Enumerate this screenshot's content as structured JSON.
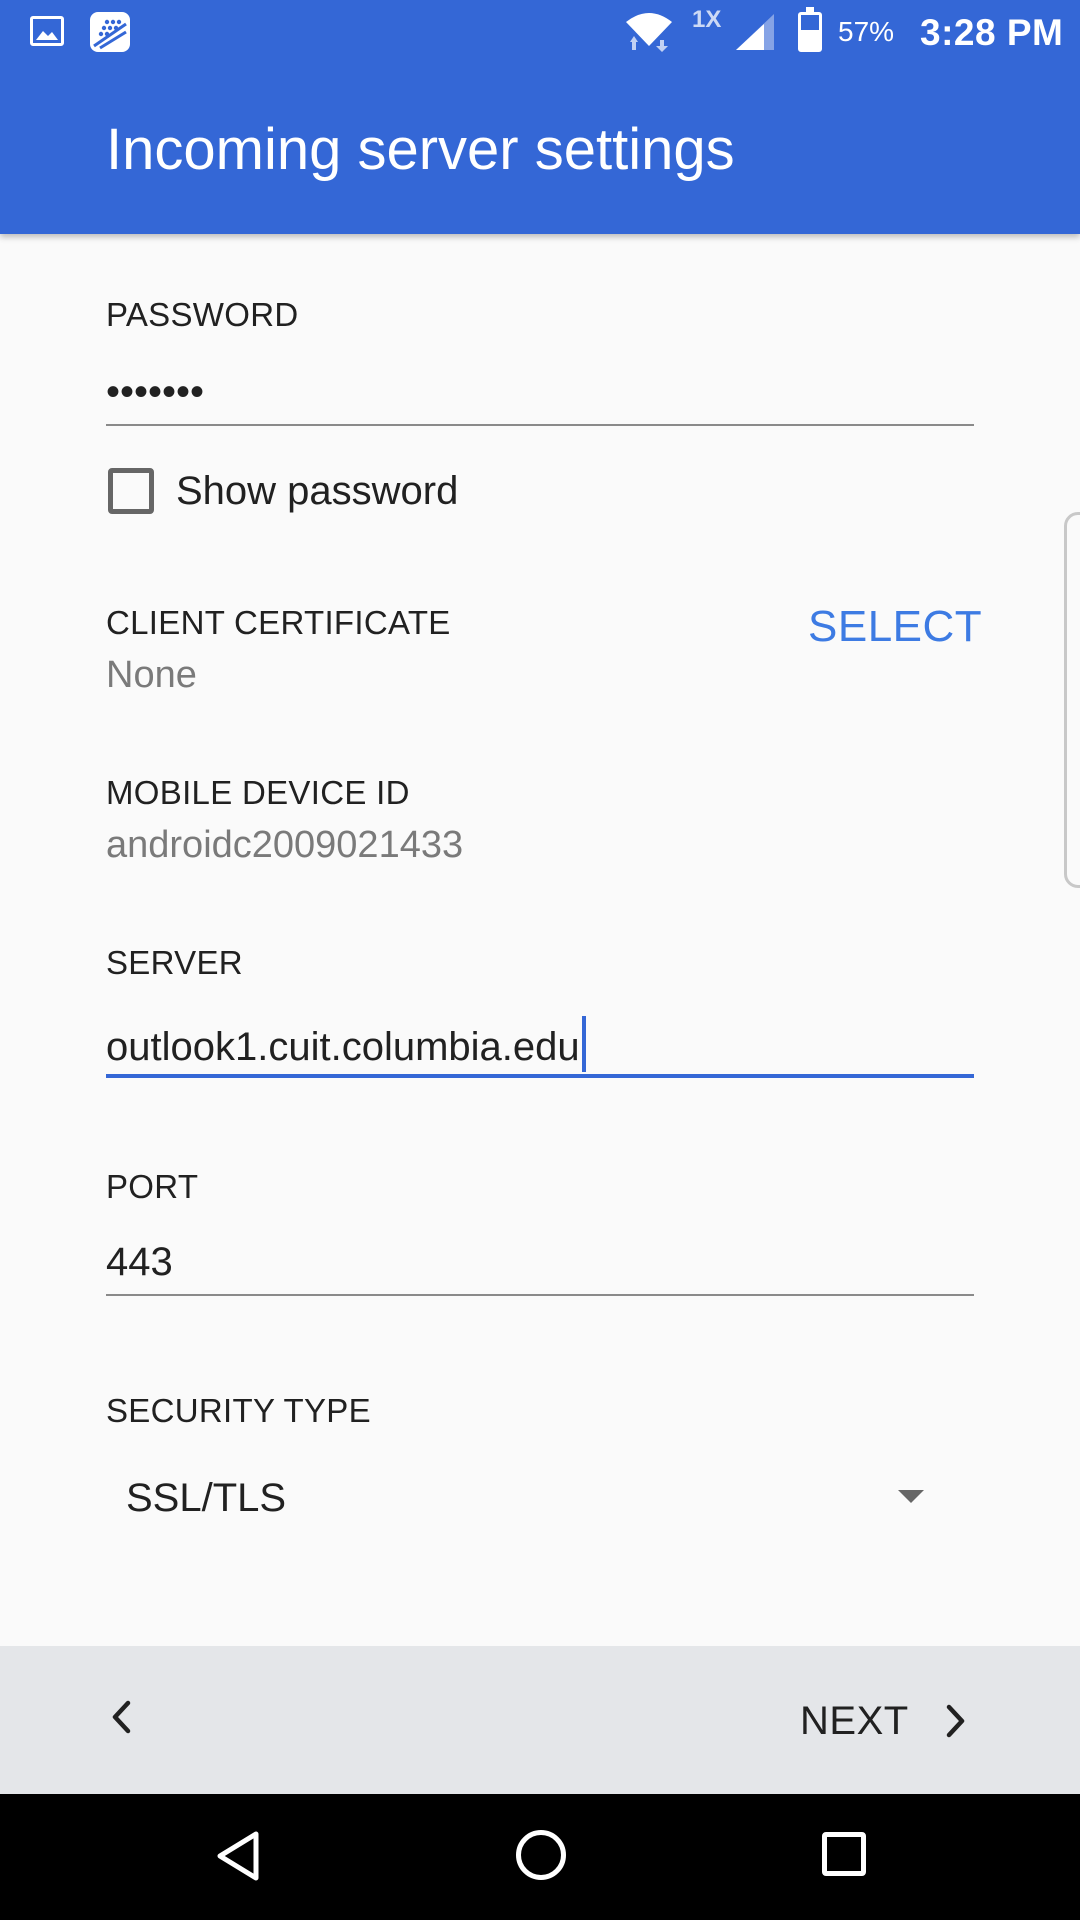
{
  "status_bar": {
    "network_type": "1X",
    "battery_percent": "57%",
    "battery_level": 0.57,
    "time": "3:28 PM",
    "icons": [
      "gallery-icon",
      "bbm-icon",
      "wifi-icon",
      "signal-icon",
      "battery-icon"
    ]
  },
  "app_bar": {
    "title": "Incoming server settings"
  },
  "form": {
    "password": {
      "label": "PASSWORD",
      "value": "•••••••"
    },
    "show_password": {
      "label": "Show password",
      "checked": false
    },
    "client_certificate": {
      "label": "CLIENT CERTIFICATE",
      "value": "None",
      "action": "SELECT"
    },
    "mobile_device_id": {
      "label": "MOBILE DEVICE ID",
      "value": "androidc2009021433"
    },
    "server": {
      "label": "SERVER",
      "value": "outlook1.cuit.columbia.edu"
    },
    "port": {
      "label": "PORT",
      "value": "443"
    },
    "security_type": {
      "label": "SECURITY TYPE",
      "value": "SSL/TLS"
    }
  },
  "bottom_bar": {
    "next_label": "NEXT"
  },
  "colors": {
    "accent": "#3467d6",
    "link": "#3d7be3",
    "bottom_bar": "#e4e6e9"
  }
}
